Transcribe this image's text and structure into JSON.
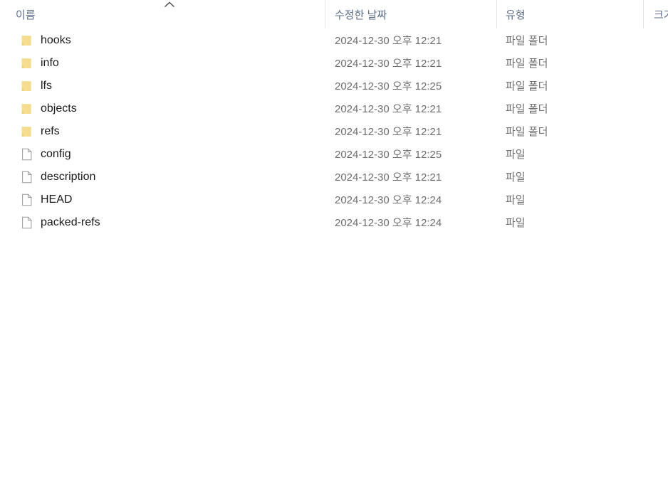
{
  "window": {
    "title": "File Explorer - Details view",
    "background_color": "#ffffff"
  },
  "colors": {
    "header_text": "#5d6e8a",
    "name_text": "#1b1b1b",
    "secondary_text": "#6e6e6e",
    "divider": "#e2e2e2",
    "folder_icon": "#f5dd8f",
    "folder_icon_dark": "#ecd06a",
    "file_icon_border": "#9a9a9a",
    "file_icon_fill": "#fdfdfd"
  },
  "columns": {
    "name": {
      "label": "이름",
      "sort": "ascending",
      "sort_icon": "chevron-up-icon"
    },
    "date_modified": {
      "label": "수정한 날짜"
    },
    "type": {
      "label": "유형"
    },
    "size": {
      "label": "크기"
    }
  },
  "files": [
    {
      "name": "hooks",
      "icon": "folder-icon",
      "date_modified": "2024-12-30 오후 12:21",
      "type": "파일 폴더",
      "size": ""
    },
    {
      "name": "info",
      "icon": "folder-icon",
      "date_modified": "2024-12-30 오후 12:21",
      "type": "파일 폴더",
      "size": ""
    },
    {
      "name": "lfs",
      "icon": "folder-icon",
      "date_modified": "2024-12-30 오후 12:25",
      "type": "파일 폴더",
      "size": ""
    },
    {
      "name": "objects",
      "icon": "folder-icon",
      "date_modified": "2024-12-30 오후 12:21",
      "type": "파일 폴더",
      "size": ""
    },
    {
      "name": "refs",
      "icon": "folder-icon",
      "date_modified": "2024-12-30 오후 12:21",
      "type": "파일 폴더",
      "size": ""
    },
    {
      "name": "config",
      "icon": "file-icon",
      "date_modified": "2024-12-30 오후 12:25",
      "type": "파일",
      "size": ""
    },
    {
      "name": "description",
      "icon": "file-icon",
      "date_modified": "2024-12-30 오후 12:21",
      "type": "파일",
      "size": ""
    },
    {
      "name": "HEAD",
      "icon": "file-icon",
      "date_modified": "2024-12-30 오후 12:24",
      "type": "파일",
      "size": ""
    },
    {
      "name": "packed-refs",
      "icon": "file-icon",
      "date_modified": "2024-12-30 오후 12:24",
      "type": "파일",
      "size": ""
    }
  ]
}
